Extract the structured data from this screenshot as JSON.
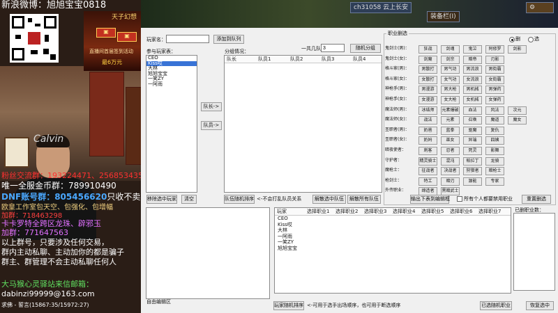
{
  "overlay": {
    "weibo": "新浪微博：旭旭宝宝0818",
    "fans_group": "粉丝交流群：193224471、256853435",
    "gold_group_label": "唯一全服金币群：",
    "gold_group_num": "789910490",
    "dnf_label": "DNF账号群：",
    "dnf_num": "805456620",
    "dnf_note": "只收不卖",
    "studio_line": "欧皇工作室包天空、包强化、包增幅",
    "studio_group": "加群：718463298",
    "kaluo_line": "卡卡罗特全跨区龙珠、辟邪玉",
    "kaluo_group": "加群：771647563",
    "notice1": "以上群号，只要涉及任何交易，",
    "notice2": "群内主动私聊、主动加你的都是骗子",
    "notice3": "群主、群管理不会主动私聊任何人",
    "horse_line": "大马猴心灵驿站来信邮箱：",
    "email": "dabinzi99999@163.com",
    "song": "求佛 - 誓言(15867:35/15972:27)",
    "shirt": "Calvin",
    "ad_top": "天子幻想",
    "ad_bottom": "直播间首届签到活动",
    "ad_prize": "最6万元"
  },
  "game_top": {
    "player_tag": "ch31058",
    "server": "云上长安",
    "panel": "装备栏(I)"
  },
  "form": {
    "player_name_label": "玩家名：",
    "player_name_value": "",
    "add_button": "添加到队列",
    "roster_label": "参与玩家表：",
    "roster": [
      {
        "name": "CEO",
        "selected": false
      },
      {
        "name": "Kiss哎",
        "selected": true
      },
      {
        "name": "大林",
        "selected": false
      },
      {
        "name": "旭旭宝宝",
        "selected": false
      },
      {
        "name": "一笑ZY",
        "selected": false
      },
      {
        "name": "一阿雨",
        "selected": false
      }
    ],
    "to_team_button": "队长->",
    "to_member_button": "队员->",
    "team_size_label": "一共几队",
    "team_size_value": "3",
    "random_group_button": "随机分组",
    "group_label": "分组情况：",
    "group_headers": [
      "队长",
      "队员1",
      "队员2",
      "队员3",
      "队员4"
    ],
    "remove_button": "移除选中玩家",
    "clear_button": "清空",
    "shuffle_button": "队伍随机排序",
    "hint_no_team": "<-不会打乱队员关系",
    "dissolve_button": "解散选中队伍",
    "dissolve_all_button": "解散所有队伍"
  },
  "roles": {
    "title": "职业删选",
    "radio_yes": "删",
    "radio_no": "选",
    "rows": [
      {
        "label": "鬼剑士(男)：",
        "items": [
          "狂战",
          "剑魂",
          "鬼泣",
          "阿修罗",
          "剑影"
        ]
      },
      {
        "label": "鬼剑士(女)：",
        "items": [
          "剑魔",
          "剑宗",
          "暗帝",
          "刃影"
        ]
      },
      {
        "label": "格斗家(男)：",
        "items": [
          "男散打",
          "男气功",
          "男流浪",
          "男街霸"
        ]
      },
      {
        "label": "格斗家(女)：",
        "items": [
          "女散打",
          "女气功",
          "女流浪",
          "女街霸"
        ]
      },
      {
        "label": "神枪手(男)：",
        "items": [
          "男漫游",
          "男大枪",
          "男机械",
          "男弹药"
        ]
      },
      {
        "label": "神枪手(女)：",
        "items": [
          "女漫游",
          "女大枪",
          "女机械",
          "女弹药"
        ]
      },
      {
        "label": "魔法师(男)：",
        "items": [
          "冰结师",
          "元素爆破",
          "血法",
          "风法",
          "次元"
        ]
      },
      {
        "label": "魔法师(女)：",
        "items": [
          "战法",
          "元素",
          "召唤",
          "魔道",
          "魔女"
        ]
      },
      {
        "label": "圣职者(男)：",
        "items": [
          "奶爸",
          "蓝拳",
          "驱魔",
          "复仇"
        ]
      },
      {
        "label": "圣职者(女)：",
        "items": [
          "奶妈",
          "巫女",
          "异端",
          "四姨"
        ]
      },
      {
        "label": "暗夜使者：",
        "items": [
          "刺客",
          "忍者",
          "死灵",
          "影舞"
        ]
      },
      {
        "label": "守护者：",
        "items": [
          "精灵骑士",
          "混沌",
          "帕拉丁",
          "龙骑"
        ]
      },
      {
        "label": "魔枪士：",
        "items": [
          "征战者",
          "决战者",
          "狩猎者",
          "暗枪士"
        ]
      },
      {
        "label": "枪剑士：",
        "items": [
          "特工",
          "暗刃",
          "源能",
          "专家"
        ]
      },
      {
        "label": "外传职业：",
        "items": [
          "缔造者",
          "黑暗武士"
        ]
      }
    ],
    "export_button": "输出下表到编辑框",
    "check_label": "所有个人都要禁用职业",
    "recheck_button": "重置删选"
  },
  "bottom": {
    "columns": [
      "玩家",
      "选择职业1",
      "选择职业2",
      "选择职业3",
      "选择职业4",
      "选择职业5",
      "选择职业6",
      "选择职业7"
    ],
    "players": [
      "CEO",
      "Kiss哎",
      "大林",
      "一阿雨",
      "一笑ZY",
      "旭旭宝宝"
    ],
    "selected_label": "已删职业数：",
    "edit_label": "自由编辑区",
    "player_shuffle_button": "玩家随机排序",
    "hint_order": "<-可用于选手出场顺序，也可用于断选顺序",
    "selected_roles_button": "已选随机职业",
    "reset_button": "恢复选中"
  }
}
